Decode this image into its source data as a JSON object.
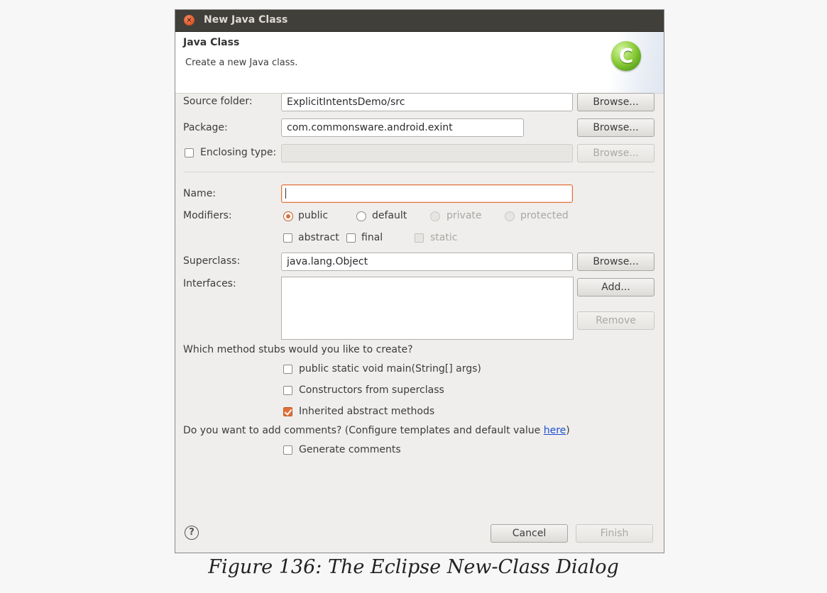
{
  "window": {
    "title": "New Java Class"
  },
  "header": {
    "title": "Java Class",
    "description": "Create a new Java class.",
    "badge_letter": "C"
  },
  "source_folder": {
    "label": "Source folder:",
    "value": "ExplicitIntentsDemo/src",
    "browse_label": "Browse..."
  },
  "package": {
    "label": "Package:",
    "value": "com.commonsware.android.exint",
    "browse_label": "Browse..."
  },
  "enclosing_type": {
    "label": "Enclosing type:",
    "checked": false,
    "value": "",
    "browse_label": "Browse..."
  },
  "name": {
    "label": "Name:",
    "value": ""
  },
  "modifiers": {
    "label": "Modifiers:",
    "access": [
      "public",
      "default",
      "private",
      "protected"
    ],
    "selected": "public",
    "abstract_label": "abstract",
    "final_label": "final",
    "static_label": "static"
  },
  "superclass": {
    "label": "Superclass:",
    "value": "java.lang.Object",
    "browse_label": "Browse..."
  },
  "interfaces": {
    "label": "Interfaces:",
    "add_label": "Add...",
    "remove_label": "Remove",
    "items": []
  },
  "stubs": {
    "question": "Which method stubs would you like to create?",
    "options": [
      {
        "label": "public static void main(String[] args)",
        "checked": false
      },
      {
        "label": "Constructors from superclass",
        "checked": false
      },
      {
        "label": "Inherited abstract methods",
        "checked": true
      }
    ]
  },
  "comments": {
    "question_prefix": "Do you want to add comments? (Configure templates and default value ",
    "link_text": "here",
    "question_suffix": ")",
    "generate_label": "Generate comments",
    "generate_checked": false
  },
  "footer": {
    "cancel_label": "Cancel",
    "finish_label": "Finish",
    "help_symbol": "?"
  },
  "caption": "Figure 136: The Eclipse New-Class Dialog",
  "colors": {
    "accent": "#e0703a",
    "titlebar": "#403f3a",
    "dialog_bg": "#efeeec",
    "link": "#1f4fd0"
  }
}
